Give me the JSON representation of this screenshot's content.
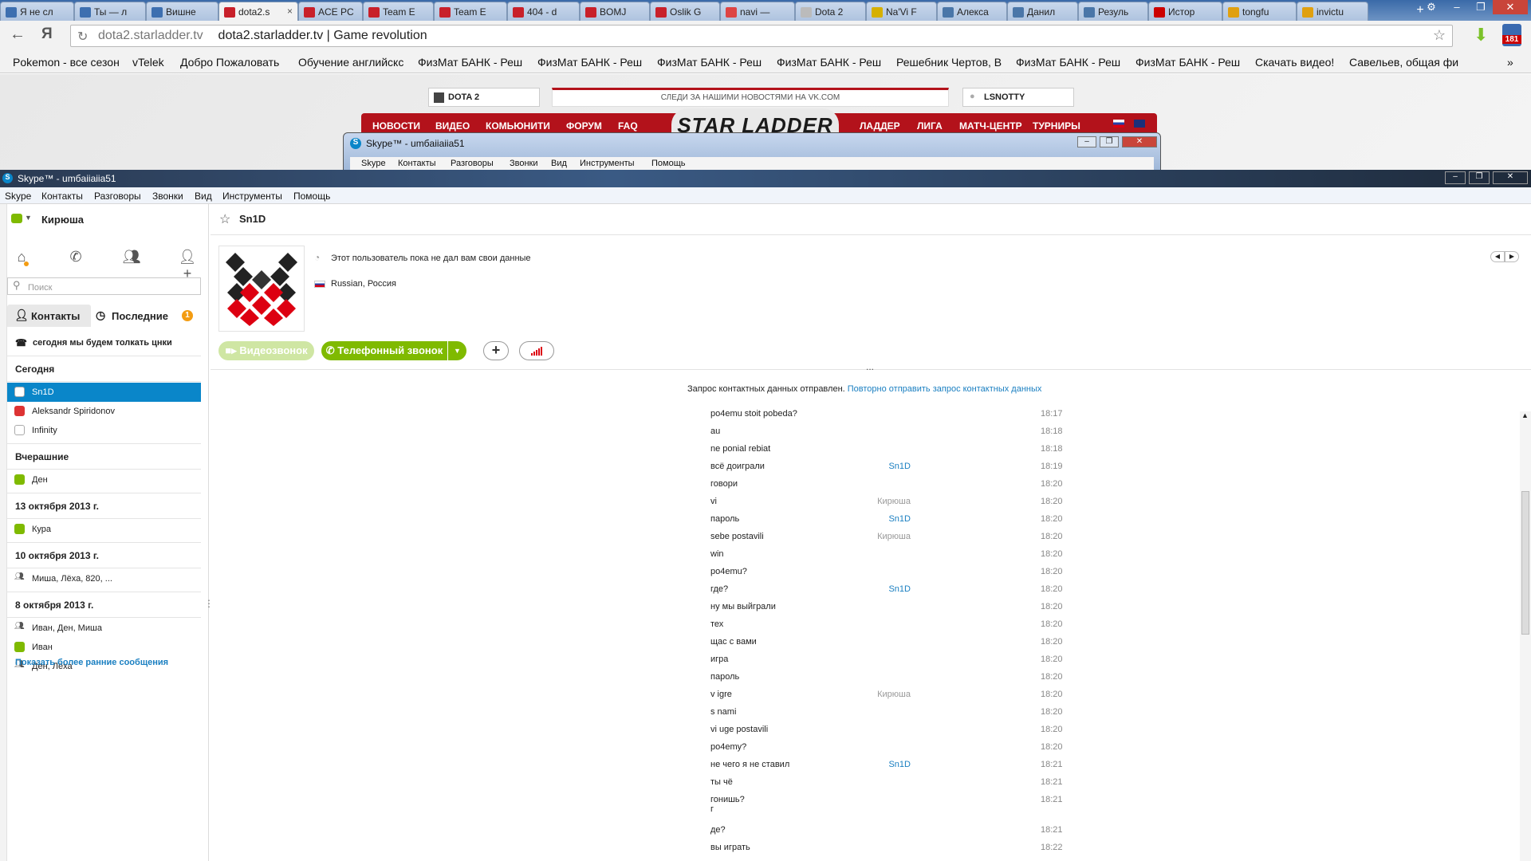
{
  "browser": {
    "tabs": [
      {
        "label": "Я не сл",
        "fav": "#3d6fb0"
      },
      {
        "label": "Ты — л",
        "fav": "#3d6fb0"
      },
      {
        "label": "Вишне",
        "fav": "#3d6fb0"
      },
      {
        "label": "dota2.s",
        "fav": "#c8202a",
        "active": true
      },
      {
        "label": "ACE PC",
        "fav": "#c8202a"
      },
      {
        "label": "Team E",
        "fav": "#c8202a"
      },
      {
        "label": "Team E",
        "fav": "#c8202a"
      },
      {
        "label": "404 - d",
        "fav": "#c8202a"
      },
      {
        "label": "BOMJ",
        "fav": "#c8202a"
      },
      {
        "label": "Oslik G",
        "fav": "#c8202a"
      },
      {
        "label": "navi —",
        "fav": "#d44"
      },
      {
        "label": "Dota 2",
        "fav": "#bbb"
      },
      {
        "label": "Na'Vi F",
        "fav": "#d6b000"
      },
      {
        "label": "Алекса",
        "fav": "#4a76a8"
      },
      {
        "label": "Данил",
        "fav": "#4a76a8"
      },
      {
        "label": "Резуль",
        "fav": "#4a76a8"
      },
      {
        "label": "Истор",
        "fav": "#c00"
      },
      {
        "label": "tongfu",
        "fav": "#e0a010"
      },
      {
        "label": "invictu",
        "fav": "#e0a010"
      }
    ],
    "url_host": "dota2.starladder.tv",
    "url_title": "dota2.starladder.tv | Game revolution",
    "yandex_glyph": "Я",
    "badge_count": "181",
    "bookmarks": [
      "Pokemon - все сезон",
      "vTelek",
      "Добро Пожаловать",
      "Обучение английскс",
      "ФизМат БАНК - Реш",
      "ФизМат БАНК - Реш",
      "ФизМат БАНК - Реш",
      "ФизМат БАНК - Реш",
      "Решебник Чертов, В",
      "ФизМат БАНК - Реш",
      "ФизМат БАНК - Реш",
      "Скачать видео!",
      "Савельев, общая фи"
    ]
  },
  "website": {
    "game_select": "DOTA 2",
    "vk_banner": "СЛЕДИ ЗА НАШИМИ НОВОСТЯМИ НА VK.COM",
    "login_name": "LSNOTTY",
    "nav_left": [
      "НОВОСТИ",
      "ВИДЕО",
      "КОМЬЮНИТИ",
      "ФОРУМ",
      "FAQ"
    ],
    "logo": "STAR LADDER",
    "nav_right": [
      "ЛАДДЕР",
      "ЛИГА",
      "МАТЧ-ЦЕНТР",
      "ТУРНИРЫ"
    ]
  },
  "small_skype": {
    "title": "Skype™ - umбaiiaiia51",
    "menu": [
      "Skype",
      "Контакты",
      "Разговоры",
      "Звонки",
      "Вид",
      "Инструменты",
      "Помощь"
    ]
  },
  "skype": {
    "title": "Skype™ - umбaiiaiia51",
    "menu": [
      "Skype",
      "Контакты",
      "Разговоры",
      "Звонки",
      "Вид",
      "Инструменты",
      "Помощь"
    ],
    "profile_name": "Кирюша",
    "search_placeholder": "Поиск",
    "tabs": {
      "contacts": "Контакты",
      "recent": "Последние",
      "recent_badge": "1"
    },
    "mood": "сегодня мы будем толкать цнки",
    "groups": [
      {
        "head": "Сегодня",
        "items": [
          {
            "name": "Sn1D",
            "status": "pending",
            "selected": true
          },
          {
            "name": "Aleksandr Spiridonov",
            "status": "red"
          },
          {
            "name": "Infinity",
            "status": "pending"
          }
        ]
      },
      {
        "head": "Вчерашние",
        "items": [
          {
            "name": "Ден",
            "status": "green"
          }
        ]
      },
      {
        "head": "13 октября 2013 г.",
        "items": [
          {
            "name": "Кура",
            "status": "green"
          }
        ]
      },
      {
        "head": "10 октября 2013 г.",
        "items": [
          {
            "name": "Миша, Лёха, 820, ...",
            "status": "group"
          }
        ]
      },
      {
        "head": "8 октября 2013 г.",
        "items": [
          {
            "name": "Иван, Ден, Миша",
            "status": "group"
          },
          {
            "name": "Иван",
            "status": "green"
          },
          {
            "name": "Ден, Лёха",
            "status": "group"
          }
        ]
      }
    ],
    "show_older": "Показать более ранние сообщения",
    "chat": {
      "contact": "Sn1D",
      "info_note": "Этот пользователь пока не дал вам свои данные",
      "location": "Russian, Россия",
      "video_call": "Видеозвонок",
      "phone_call": "Телефонный звонок",
      "ellipsis": "...",
      "request_sent": "Запрос контактных данных отправлен.",
      "resend_link": "Повторно отправить запрос контактных данных",
      "messages": [
        {
          "name": "",
          "text": "po4emu stoit pobeda?",
          "time": "18:17"
        },
        {
          "name": "",
          "text": "au",
          "time": "18:18"
        },
        {
          "name": "",
          "text": "ne ponial rebiat",
          "time": "18:18"
        },
        {
          "name": "Sn1D",
          "text": "всё доиграли",
          "time": "18:19"
        },
        {
          "name": "",
          "text": "говори",
          "time": "18:20"
        },
        {
          "name": "Кирюша",
          "text": "vi",
          "time": "18:20"
        },
        {
          "name": "Sn1D",
          "text": "пароль",
          "time": "18:20"
        },
        {
          "name": "Кирюша",
          "text": "sebe postavili",
          "time": "18:20"
        },
        {
          "name": "",
          "text": "win",
          "time": "18:20"
        },
        {
          "name": "",
          "text": "po4emu?",
          "time": "18:20"
        },
        {
          "name": "Sn1D",
          "text": "где?",
          "time": "18:20"
        },
        {
          "name": "",
          "text": "ну мы выйграли",
          "time": "18:20"
        },
        {
          "name": "",
          "text": "тех",
          "time": "18:20"
        },
        {
          "name": "",
          "text": "щас с вами",
          "time": "18:20"
        },
        {
          "name": "",
          "text": "игра",
          "time": "18:20"
        },
        {
          "name": "",
          "text": "пароль",
          "time": "18:20"
        },
        {
          "name": "Кирюша",
          "text": "v igre",
          "time": "18:20"
        },
        {
          "name": "",
          "text": "s nami",
          "time": "18:20"
        },
        {
          "name": "",
          "text": "vi uge postavili",
          "time": "18:20"
        },
        {
          "name": "",
          "text": "po4emy?",
          "time": "18:20"
        },
        {
          "name": "Sn1D",
          "text": "не чего я не ставил",
          "time": "18:21"
        },
        {
          "name": "",
          "text": "ты чё",
          "time": "18:21"
        },
        {
          "name": "",
          "text": "гонишь?\nг",
          "time": "18:21"
        },
        {
          "name": "",
          "text": "де?",
          "time": "18:21"
        },
        {
          "name": "",
          "text": "вы играть",
          "time": "18:22"
        }
      ]
    }
  },
  "colors": {
    "skype_blue": "#0a86c9",
    "green_call": "#7fba00",
    "starladder_red": "#b3121b",
    "sn1d_name": "#1a7fc1",
    "kiryusha_name": "#999999"
  }
}
